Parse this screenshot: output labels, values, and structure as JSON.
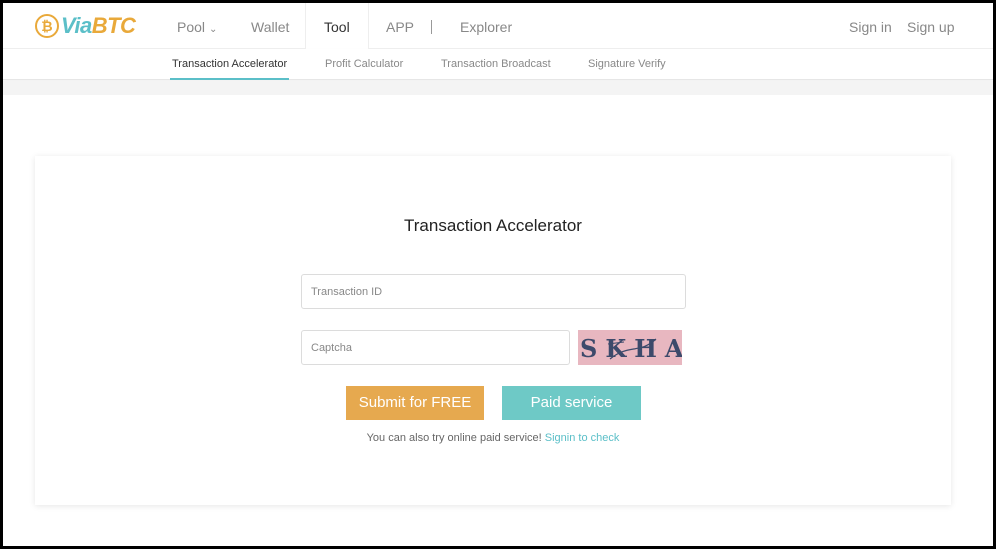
{
  "brand": {
    "icon": "bitcoin-coin-icon",
    "via": "Via",
    "btc": "BTC"
  },
  "nav": {
    "pool": "Pool",
    "wallet": "Wallet",
    "tool": "Tool",
    "app": "APP",
    "explorer": "Explorer",
    "sign_in": "Sign in",
    "sign_up": "Sign up"
  },
  "subnav": {
    "items": [
      "Transaction Accelerator",
      "Profit Calculator",
      "Transaction Broadcast",
      "Signature Verify"
    ],
    "active": "Transaction Accelerator"
  },
  "form": {
    "title": "Transaction Accelerator",
    "txid_placeholder": "Transaction ID",
    "captcha_placeholder": "Captcha",
    "captcha_text": "SKHA",
    "submit_free": "Submit for FREE",
    "paid_service": "Paid service",
    "note_text": "You can also try online paid service! ",
    "note_link": "Signin to check"
  },
  "colors": {
    "accent_teal": "#5bbfc8",
    "accent_orange": "#e6a94f",
    "paid_button": "#6ec9c6"
  }
}
